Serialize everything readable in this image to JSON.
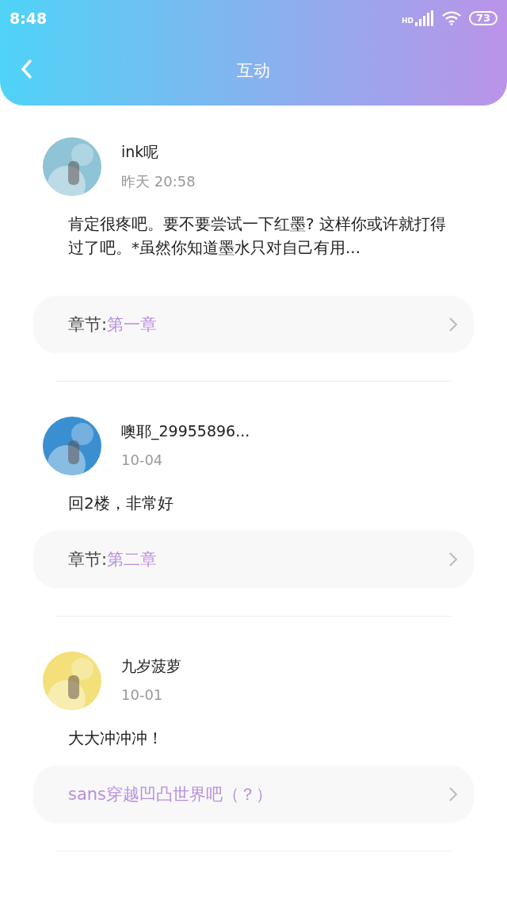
{
  "status_bar": {
    "time": "8:48",
    "network": "HD",
    "battery": "73"
  },
  "header": {
    "title": "互动"
  },
  "comments": [
    {
      "user": "ink呢",
      "time": "昨天 20:58",
      "text": "肯定很疼吧。要不要尝试一下红墨? 这样你或许就打得过了吧。*虽然你知道墨水只对自己有用...",
      "link": {
        "kind": "chapter",
        "label": "章节:",
        "value": "第一章"
      }
    },
    {
      "user": "噢耶_29955896...",
      "time": "10-04",
      "text": "回2楼，非常好",
      "link": {
        "kind": "chapter",
        "label": "章节:",
        "value": "第二章"
      }
    },
    {
      "user": "九岁菠萝",
      "time": "10-01",
      "text": "大大冲冲冲！",
      "link": {
        "kind": "book",
        "value": "sans穿越凹凸世界吧（？）"
      }
    }
  ]
}
